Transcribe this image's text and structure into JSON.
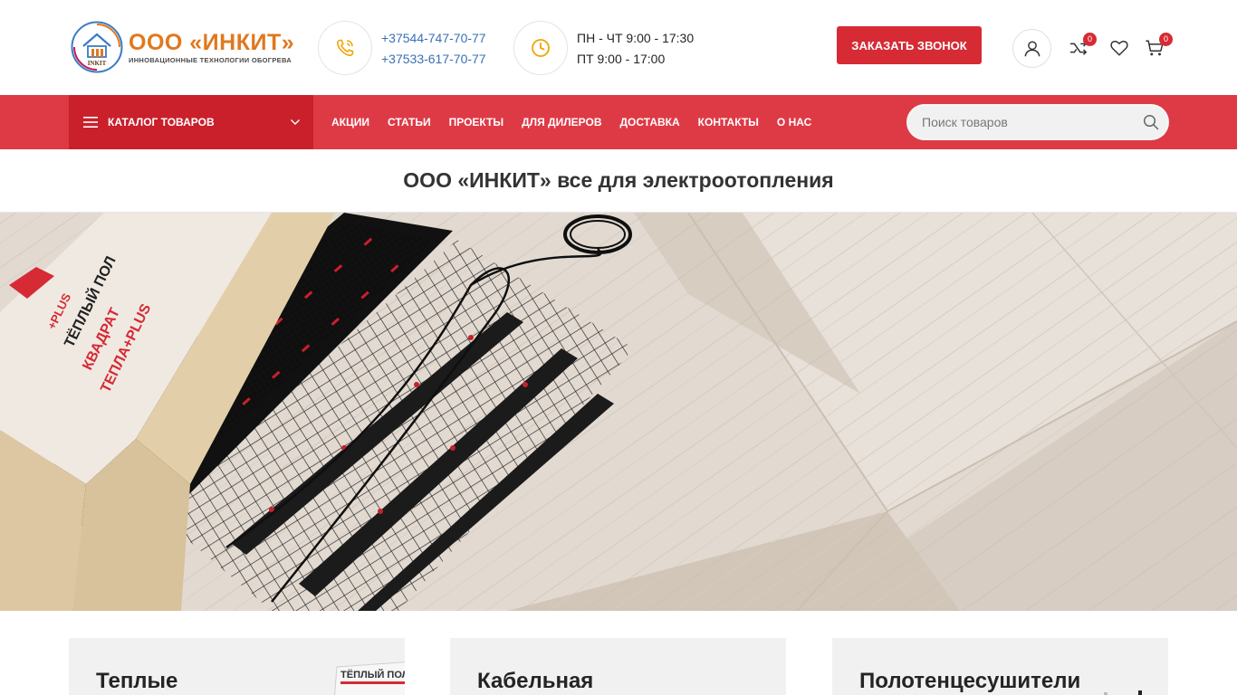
{
  "header": {
    "logo": {
      "title": "ООО «ИНКИТ»",
      "subtitle": "ИННОВАЦИОННЫЕ ТЕХНОЛОГИИ ОБОГРЕВА",
      "mark_text": "INKIT"
    },
    "phones": [
      "+37544-747-70-77",
      "+37533-617-70-77"
    ],
    "hours": [
      "ПН - ЧТ 9:00 - 17:30",
      "ПТ 9:00 - 17:00"
    ],
    "call_button": "ЗАКАЗАТЬ ЗВОНОК",
    "compare_count": "0",
    "cart_count": "0",
    "icons": [
      "phone-icon",
      "clock-icon",
      "user-icon",
      "compare-icon",
      "heart-icon",
      "cart-icon"
    ]
  },
  "nav": {
    "catalog_label": "КАТАЛОГ ТОВАРОВ",
    "links": [
      "АКЦИИ",
      "СТАТЬИ",
      "ПРОЕКТЫ",
      "ДЛЯ ДИЛЕРОВ",
      "ДОСТАВКА",
      "КОНТАКТЫ",
      "О НАС"
    ],
    "search_placeholder": "Поиск товаров"
  },
  "page": {
    "title": "ООО «ИНКИТ» все для электроотопления"
  },
  "hero": {
    "box_text": [
      "+PLUS",
      "ТЁПЛЫЙ ПОЛ",
      "КВАДРАТ",
      "ТЕПЛА+PLUS"
    ]
  },
  "categories": [
    {
      "title": "Теплые",
      "thumb_text": "ТЁПЛЫЙ ПОЛ"
    },
    {
      "title": "Кабельная"
    },
    {
      "title": "Полотенцесушители"
    }
  ],
  "colors": {
    "brand_red": "#d62b35",
    "nav_red": "#de3a46",
    "catalog_red": "#c9202c",
    "logo_orange": "#e0781e",
    "link_blue": "#3a6fb6"
  }
}
